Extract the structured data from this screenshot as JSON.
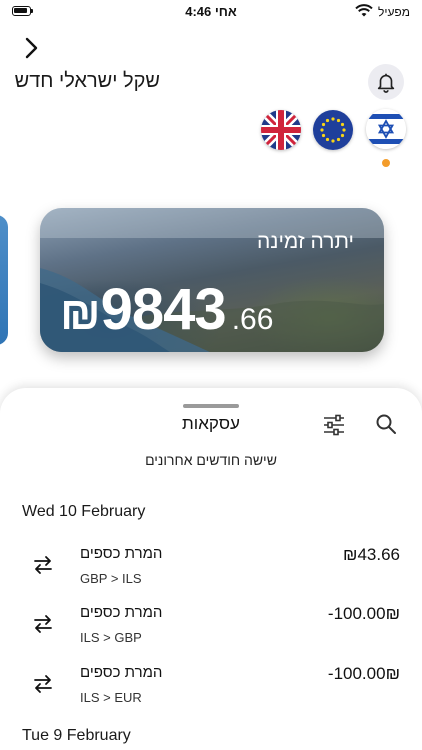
{
  "status_bar": {
    "time": "4:46 אחי",
    "carrier": "מפעיל"
  },
  "header": {
    "currency_name": "שקל ישראלי חדש"
  },
  "flags": [
    {
      "icon": "israel-flag-icon"
    },
    {
      "icon": "eu-flag-icon"
    },
    {
      "icon": "uk-flag-icon"
    }
  ],
  "balance_card": {
    "label": "יתרה זמינה",
    "currency_symbol": "₪",
    "amount_integer": "9843",
    "amount_decimal": ".66"
  },
  "transactions_sheet": {
    "title": "עסקאות",
    "period": "שישה חודשים אחרונים",
    "groups": [
      {
        "date": "Wed 10 February",
        "items": [
          {
            "title": "המרת כספים",
            "pair": "GBP > ILS",
            "amount": "₪43.66"
          },
          {
            "title": "המרת כספים",
            "pair": "ILS > GBP",
            "amount": "-100.00₪"
          },
          {
            "title": "המרת כספים",
            "pair": "ILS > EUR",
            "amount": "-100.00₪"
          }
        ]
      },
      {
        "date": "Tue 9 February",
        "items": []
      }
    ]
  },
  "colors": {
    "accent_dot": "#f39c2a",
    "bell_bg": "#ececf1"
  }
}
